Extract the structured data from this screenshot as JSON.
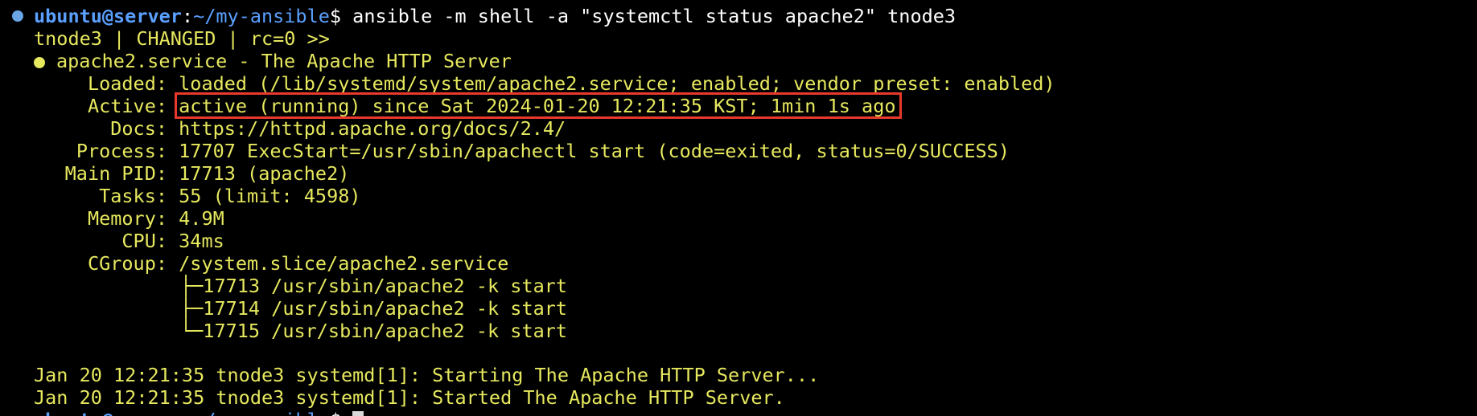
{
  "colors": {
    "background": "#000000",
    "output_yellow": "#e6e85e",
    "prompt_blue": "#5aa0ff",
    "highlight_red": "#e8392c"
  },
  "prompt": {
    "user_host": "ubuntu@server",
    "separator": ":",
    "cwd": "~/my-ansible",
    "symbol": "$",
    "command": " ansible -m shell -a \"systemctl status apache2\" tnode3"
  },
  "result_header": "tnode3 | CHANGED | rc=0 >>",
  "service_title": "apache2.service - The Apache HTTP Server",
  "status_fields": [
    {
      "label": "Loaded:",
      "value": "loaded (/lib/systemd/system/apache2.service; enabled; vendor preset: enabled)"
    },
    {
      "label": "Active:",
      "value": "active (running) since Sat 2024-01-20 12:21:35 KST; 1min 1s ago"
    },
    {
      "label": "Docs:",
      "value": "https://httpd.apache.org/docs/2.4/"
    },
    {
      "label": "Process:",
      "value": "17707 ExecStart=/usr/sbin/apachectl start (code=exited, status=0/SUCCESS)"
    },
    {
      "label": "Main PID:",
      "value": "17713 (apache2)"
    },
    {
      "label": "Tasks:",
      "value": "55 (limit: 4598)"
    },
    {
      "label": "Memory:",
      "value": "4.9M"
    },
    {
      "label": "CPU:",
      "value": "34ms"
    },
    {
      "label": "CGroup:",
      "value": "/system.slice/apache2.service"
    }
  ],
  "cgroup_tree": [
    "├─17713 /usr/sbin/apache2 -k start",
    "├─17714 /usr/sbin/apache2 -k start",
    "└─17715 /usr/sbin/apache2 -k start"
  ],
  "log_lines": [
    "Jan 20 12:21:35 tnode3 systemd[1]: Starting The Apache HTTP Server...",
    "Jan 20 12:21:35 tnode3 systemd[1]: Started The Apache HTTP Server."
  ],
  "next_prompt": {
    "user_host": "ubuntu@server",
    "separator": ":",
    "cwd": "~/my-ansible",
    "symbol": "$"
  }
}
